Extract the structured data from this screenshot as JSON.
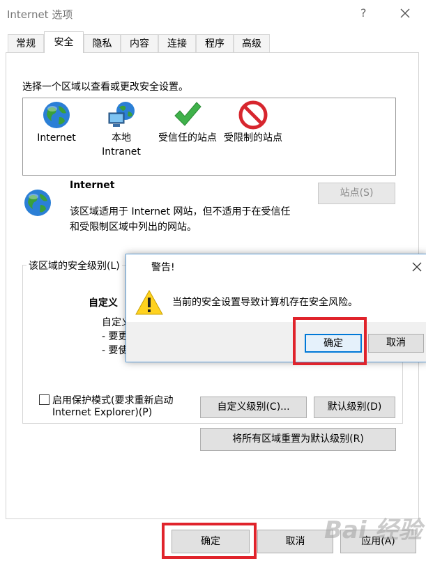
{
  "window": {
    "title": "Internet 选项",
    "help": "?",
    "close_icon": "close-icon"
  },
  "tabs": [
    {
      "label": "常规",
      "active": false
    },
    {
      "label": "安全",
      "active": true
    },
    {
      "label": "隐私",
      "active": false
    },
    {
      "label": "内容",
      "active": false
    },
    {
      "label": "连接",
      "active": false
    },
    {
      "label": "程序",
      "active": false
    },
    {
      "label": "高级",
      "active": false
    }
  ],
  "security": {
    "instruction": "选择一个区域以查看或更改安全设置。",
    "zones": [
      {
        "name": "Internet",
        "icon": "globe-icon"
      },
      {
        "name_line1": "本地",
        "name_line2": "Intranet",
        "icon": "local-intranet-icon"
      },
      {
        "name": "受信任的站点",
        "icon": "checkmark-icon"
      },
      {
        "name": "受限制的站点",
        "icon": "restricted-icon"
      }
    ],
    "selected_zone": {
      "title": "Internet",
      "desc_line1": "该区域适用于 Internet 网站，但不适用于在受信任",
      "desc_line2": "和受限制区域中列出的网站。"
    },
    "sites_button": "站点(S)",
    "level_group": {
      "legend": "该区域的安全级别(L)",
      "level_name": "自定义",
      "level_line1": "自定义",
      "level_line2": "- 要更",
      "level_line3": "- 要使"
    },
    "protected_mode": {
      "label_line1": "启用保护模式(要求重新启动",
      "label_line2": "Internet Explorer)(P)",
      "checked": false
    },
    "custom_level_button": "自定义级别(C)...",
    "default_level_button": "默认级别(D)",
    "reset_all_button": "将所有区域重置为默认级别(R)"
  },
  "footer": {
    "ok": "确定",
    "cancel": "取消",
    "apply": "应用(A)"
  },
  "warning_dialog": {
    "title": "警告!",
    "message": "当前的安全设置导致计算机存在安全风险。",
    "ok": "确定",
    "cancel": "取消",
    "icon": "warning-icon"
  },
  "watermark": "Bai 经验",
  "colors": {
    "highlight": "#e0232b",
    "dialog_border": "#5b9bd5"
  }
}
